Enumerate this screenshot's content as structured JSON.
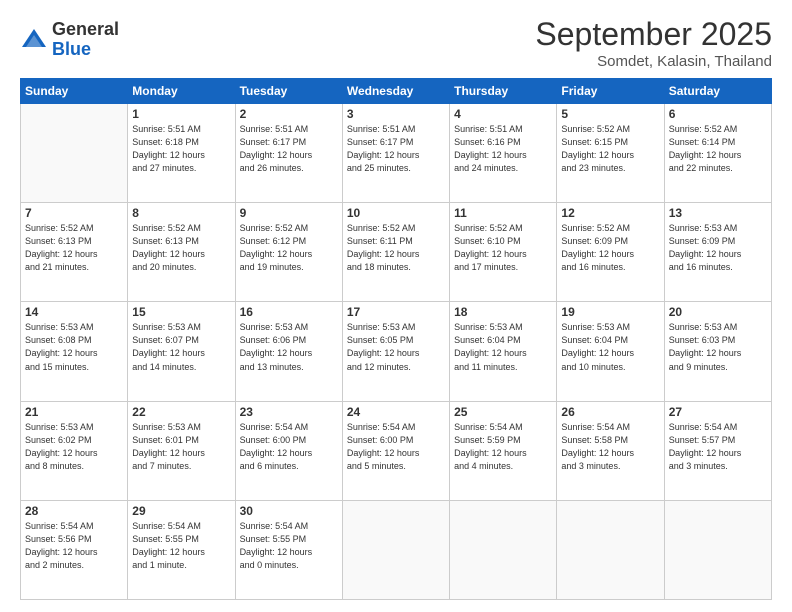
{
  "logo": {
    "general": "General",
    "blue": "Blue"
  },
  "header": {
    "month": "September 2025",
    "location": "Somdet, Kalasin, Thailand"
  },
  "weekdays": [
    "Sunday",
    "Monday",
    "Tuesday",
    "Wednesday",
    "Thursday",
    "Friday",
    "Saturday"
  ],
  "weeks": [
    [
      {
        "day": "",
        "detail": ""
      },
      {
        "day": "1",
        "detail": "Sunrise: 5:51 AM\nSunset: 6:18 PM\nDaylight: 12 hours\nand 27 minutes."
      },
      {
        "day": "2",
        "detail": "Sunrise: 5:51 AM\nSunset: 6:17 PM\nDaylight: 12 hours\nand 26 minutes."
      },
      {
        "day": "3",
        "detail": "Sunrise: 5:51 AM\nSunset: 6:17 PM\nDaylight: 12 hours\nand 25 minutes."
      },
      {
        "day": "4",
        "detail": "Sunrise: 5:51 AM\nSunset: 6:16 PM\nDaylight: 12 hours\nand 24 minutes."
      },
      {
        "day": "5",
        "detail": "Sunrise: 5:52 AM\nSunset: 6:15 PM\nDaylight: 12 hours\nand 23 minutes."
      },
      {
        "day": "6",
        "detail": "Sunrise: 5:52 AM\nSunset: 6:14 PM\nDaylight: 12 hours\nand 22 minutes."
      }
    ],
    [
      {
        "day": "7",
        "detail": "Sunrise: 5:52 AM\nSunset: 6:13 PM\nDaylight: 12 hours\nand 21 minutes."
      },
      {
        "day": "8",
        "detail": "Sunrise: 5:52 AM\nSunset: 6:13 PM\nDaylight: 12 hours\nand 20 minutes."
      },
      {
        "day": "9",
        "detail": "Sunrise: 5:52 AM\nSunset: 6:12 PM\nDaylight: 12 hours\nand 19 minutes."
      },
      {
        "day": "10",
        "detail": "Sunrise: 5:52 AM\nSunset: 6:11 PM\nDaylight: 12 hours\nand 18 minutes."
      },
      {
        "day": "11",
        "detail": "Sunrise: 5:52 AM\nSunset: 6:10 PM\nDaylight: 12 hours\nand 17 minutes."
      },
      {
        "day": "12",
        "detail": "Sunrise: 5:52 AM\nSunset: 6:09 PM\nDaylight: 12 hours\nand 16 minutes."
      },
      {
        "day": "13",
        "detail": "Sunrise: 5:53 AM\nSunset: 6:09 PM\nDaylight: 12 hours\nand 16 minutes."
      }
    ],
    [
      {
        "day": "14",
        "detail": "Sunrise: 5:53 AM\nSunset: 6:08 PM\nDaylight: 12 hours\nand 15 minutes."
      },
      {
        "day": "15",
        "detail": "Sunrise: 5:53 AM\nSunset: 6:07 PM\nDaylight: 12 hours\nand 14 minutes."
      },
      {
        "day": "16",
        "detail": "Sunrise: 5:53 AM\nSunset: 6:06 PM\nDaylight: 12 hours\nand 13 minutes."
      },
      {
        "day": "17",
        "detail": "Sunrise: 5:53 AM\nSunset: 6:05 PM\nDaylight: 12 hours\nand 12 minutes."
      },
      {
        "day": "18",
        "detail": "Sunrise: 5:53 AM\nSunset: 6:04 PM\nDaylight: 12 hours\nand 11 minutes."
      },
      {
        "day": "19",
        "detail": "Sunrise: 5:53 AM\nSunset: 6:04 PM\nDaylight: 12 hours\nand 10 minutes."
      },
      {
        "day": "20",
        "detail": "Sunrise: 5:53 AM\nSunset: 6:03 PM\nDaylight: 12 hours\nand 9 minutes."
      }
    ],
    [
      {
        "day": "21",
        "detail": "Sunrise: 5:53 AM\nSunset: 6:02 PM\nDaylight: 12 hours\nand 8 minutes."
      },
      {
        "day": "22",
        "detail": "Sunrise: 5:53 AM\nSunset: 6:01 PM\nDaylight: 12 hours\nand 7 minutes."
      },
      {
        "day": "23",
        "detail": "Sunrise: 5:54 AM\nSunset: 6:00 PM\nDaylight: 12 hours\nand 6 minutes."
      },
      {
        "day": "24",
        "detail": "Sunrise: 5:54 AM\nSunset: 6:00 PM\nDaylight: 12 hours\nand 5 minutes."
      },
      {
        "day": "25",
        "detail": "Sunrise: 5:54 AM\nSunset: 5:59 PM\nDaylight: 12 hours\nand 4 minutes."
      },
      {
        "day": "26",
        "detail": "Sunrise: 5:54 AM\nSunset: 5:58 PM\nDaylight: 12 hours\nand 3 minutes."
      },
      {
        "day": "27",
        "detail": "Sunrise: 5:54 AM\nSunset: 5:57 PM\nDaylight: 12 hours\nand 3 minutes."
      }
    ],
    [
      {
        "day": "28",
        "detail": "Sunrise: 5:54 AM\nSunset: 5:56 PM\nDaylight: 12 hours\nand 2 minutes."
      },
      {
        "day": "29",
        "detail": "Sunrise: 5:54 AM\nSunset: 5:55 PM\nDaylight: 12 hours\nand 1 minute."
      },
      {
        "day": "30",
        "detail": "Sunrise: 5:54 AM\nSunset: 5:55 PM\nDaylight: 12 hours\nand 0 minutes."
      },
      {
        "day": "",
        "detail": ""
      },
      {
        "day": "",
        "detail": ""
      },
      {
        "day": "",
        "detail": ""
      },
      {
        "day": "",
        "detail": ""
      }
    ]
  ]
}
